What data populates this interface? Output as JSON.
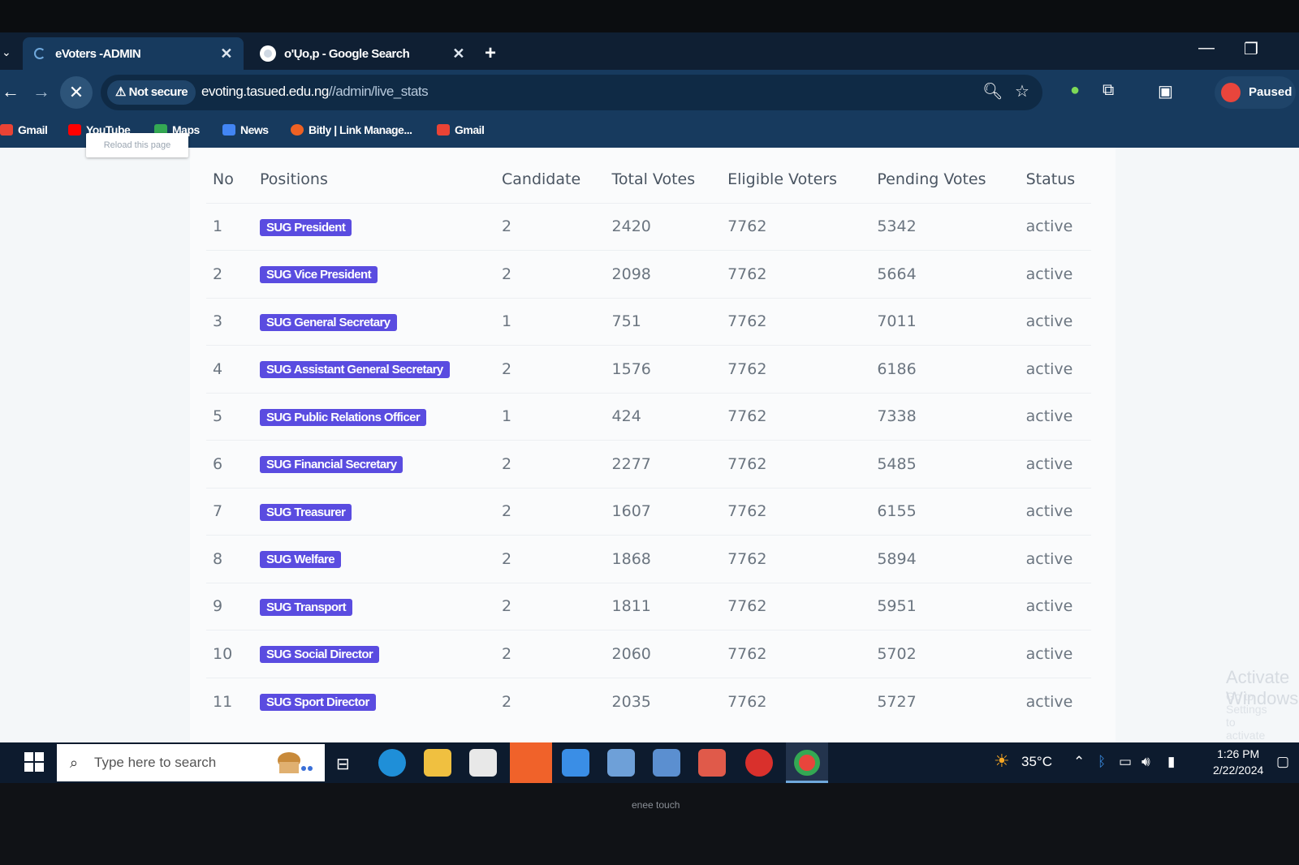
{
  "browser": {
    "tabs": [
      {
        "title": "eVoters -ADMIN",
        "active": true
      },
      {
        "title": "o'Ųo,p - Google Search",
        "active": false
      }
    ],
    "new_tab": "+",
    "not_secure": "Not secure",
    "url_host": "evoting.tasued.edu.ng",
    "url_path": "//admin/live_stats",
    "tooltip": "Reload this page",
    "profile_label": "Paused",
    "bookmarks": [
      "Gmail",
      "YouTube",
      "Maps",
      "News",
      "Bitly | Link Manage...",
      "Gmail"
    ]
  },
  "table": {
    "headers": [
      "No",
      "Positions",
      "Candidate",
      "Total Votes",
      "Eligible Voters",
      "Pending Votes",
      "Status"
    ],
    "rows": [
      {
        "no": "1",
        "position": "SUG President",
        "candidate": "2",
        "total": "2420",
        "eligible": "7762",
        "pending": "5342",
        "status": "active"
      },
      {
        "no": "2",
        "position": "SUG Vice President",
        "candidate": "2",
        "total": "2098",
        "eligible": "7762",
        "pending": "5664",
        "status": "active"
      },
      {
        "no": "3",
        "position": "SUG General Secretary",
        "candidate": "1",
        "total": "751",
        "eligible": "7762",
        "pending": "7011",
        "status": "active"
      },
      {
        "no": "4",
        "position": "SUG Assistant General Secretary",
        "candidate": "2",
        "total": "1576",
        "eligible": "7762",
        "pending": "6186",
        "status": "active"
      },
      {
        "no": "5",
        "position": "SUG Public Relations Officer",
        "candidate": "1",
        "total": "424",
        "eligible": "7762",
        "pending": "7338",
        "status": "active"
      },
      {
        "no": "6",
        "position": "SUG Financial Secretary",
        "candidate": "2",
        "total": "2277",
        "eligible": "7762",
        "pending": "5485",
        "status": "active"
      },
      {
        "no": "7",
        "position": "SUG Treasurer",
        "candidate": "2",
        "total": "1607",
        "eligible": "7762",
        "pending": "6155",
        "status": "active"
      },
      {
        "no": "8",
        "position": "SUG Welfare",
        "candidate": "2",
        "total": "1868",
        "eligible": "7762",
        "pending": "5894",
        "status": "active"
      },
      {
        "no": "9",
        "position": "SUG Transport",
        "candidate": "2",
        "total": "1811",
        "eligible": "7762",
        "pending": "5951",
        "status": "active"
      },
      {
        "no": "10",
        "position": "SUG Social Director",
        "candidate": "2",
        "total": "2060",
        "eligible": "7762",
        "pending": "5702",
        "status": "active"
      },
      {
        "no": "11",
        "position": "SUG Sport Director",
        "candidate": "2",
        "total": "2035",
        "eligible": "7762",
        "pending": "5727",
        "status": "active"
      }
    ]
  },
  "watermark": {
    "line1": "Activate Windows",
    "line2": "Go to Settings to activate Windows."
  },
  "taskbar": {
    "search_placeholder": "Type here to search",
    "weather": "35°C",
    "time": "1:26 PM",
    "date": "2/22/2024"
  },
  "monitor_brand": "enee touch",
  "colors": {
    "badge": "#5a4ce0",
    "chrome_dark": "#0f1f33",
    "chrome": "#173a5e"
  }
}
